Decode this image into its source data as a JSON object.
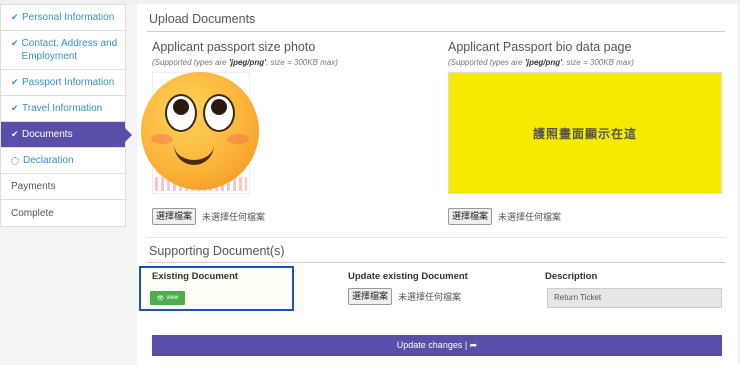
{
  "sidebar": {
    "items": [
      {
        "label": "Personal Information",
        "state": "done"
      },
      {
        "label": "Contact, Address and Employment",
        "state": "done"
      },
      {
        "label": "Passport Information",
        "state": "done"
      },
      {
        "label": "Travel Information",
        "state": "done"
      },
      {
        "label": "Documents",
        "state": "active"
      },
      {
        "label": "Declaration",
        "state": "pending"
      },
      {
        "label": "Payments",
        "state": "plain"
      },
      {
        "label": "Complete",
        "state": "plain"
      }
    ]
  },
  "upload": {
    "title": "Upload Documents",
    "photo": {
      "caption": "Applicant passport size photo",
      "note_prefix": "(Supported types are ",
      "note_types": "'jpeg/png'",
      "note_suffix": ", size = 300KB max)",
      "file_button": "選擇檔案",
      "file_status": "未選擇任何檔案"
    },
    "bio": {
      "caption": "Applicant Passport bio data page",
      "note_prefix": "(Supported types are ",
      "note_types": "'jpeg/png'",
      "note_suffix": ", size = 300KB max)",
      "placeholder_text": "護照畫面顯示在這",
      "file_button": "選擇檔案",
      "file_status": "未選擇任何檔案"
    }
  },
  "supporting": {
    "title": "Supporting Document(s)",
    "headers": {
      "existing": "Existing Document",
      "update": "Update existing Document",
      "description": "Description"
    },
    "view_label": "view",
    "file_button": "選擇檔案",
    "file_status": "未選擇任何檔案",
    "description_value": "Return Ticket"
  },
  "actions": {
    "update_label": "Update changes | ➦"
  },
  "colors": {
    "accent": "#5a4fa8",
    "success": "#4cae4c",
    "highlight": "#1f4fbf",
    "bio_bg": "#f5ea00"
  }
}
